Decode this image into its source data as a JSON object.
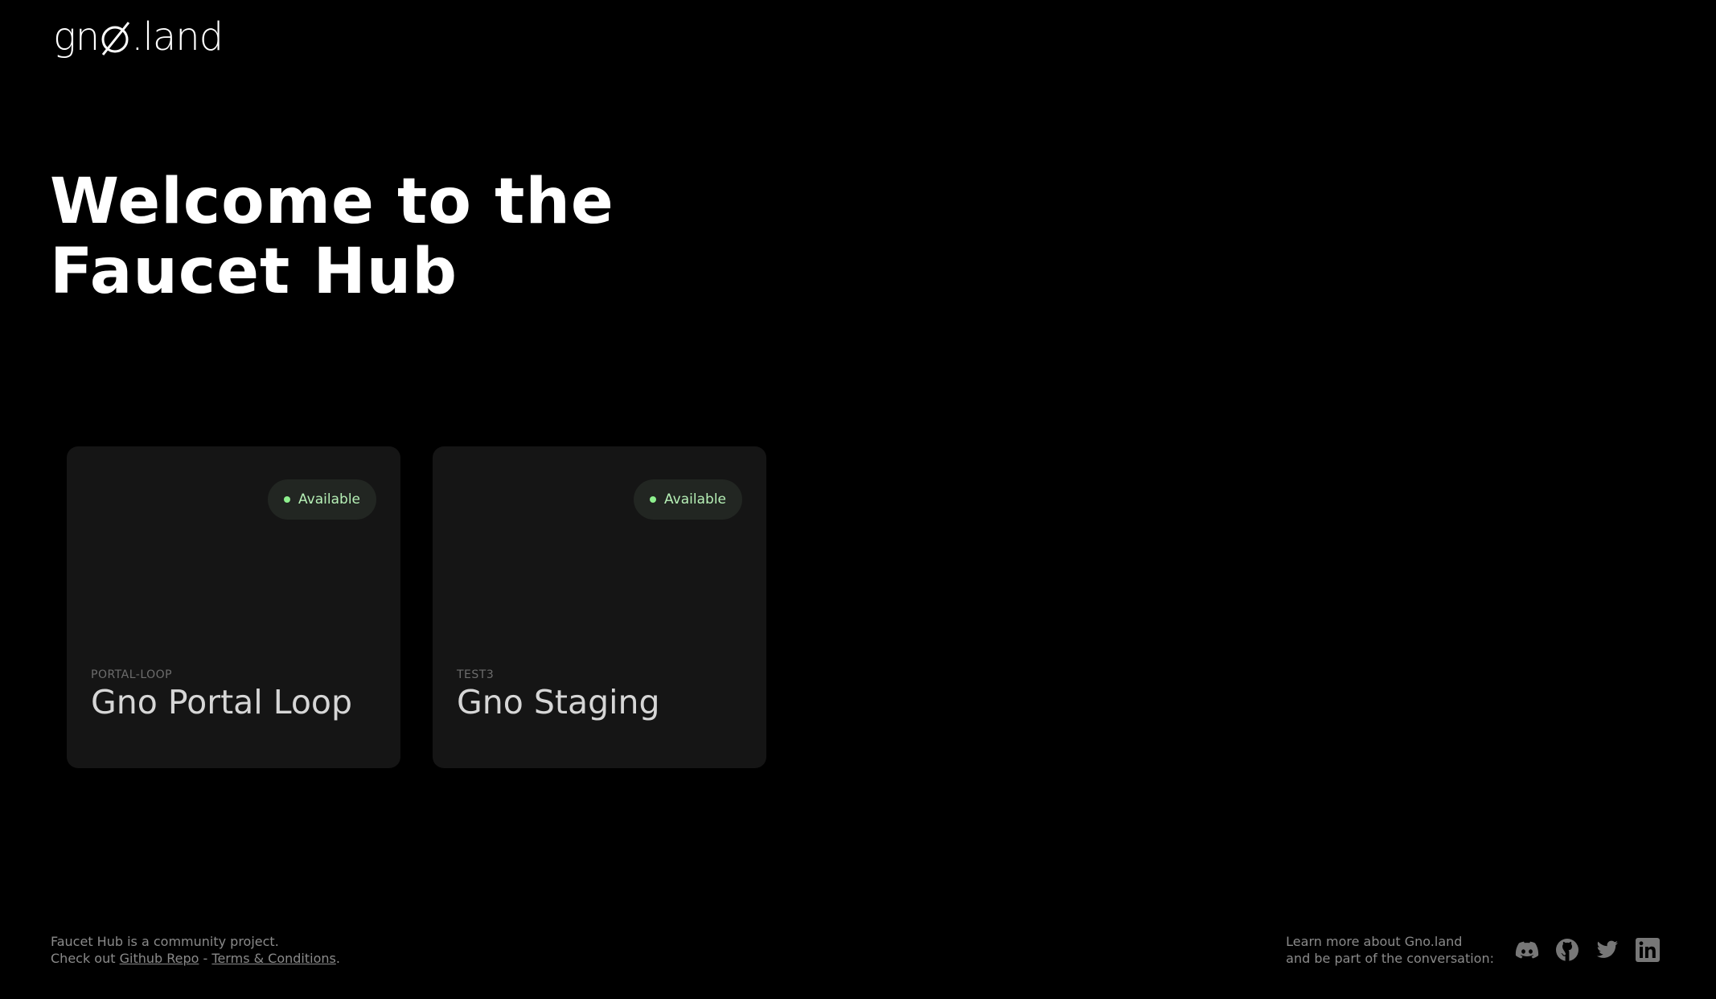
{
  "header": {
    "logo_left": "gn",
    "logo_right": ".land",
    "logo_icon": "slashed-o-icon"
  },
  "hero": {
    "line1": "Welcome to the",
    "line2": "Faucet Hub"
  },
  "faucets": [
    {
      "status": "Available",
      "slug": "PORTAL-LOOP",
      "name": "Gno Portal Loop"
    },
    {
      "status": "Available",
      "slug": "TEST3",
      "name": "Gno Staging"
    }
  ],
  "footer": {
    "left_line1": "Faucet Hub is a community project.",
    "left_line2_prefix": "Check out",
    "github_link": "Github Repo",
    "separator": "-",
    "terms_link": "Terms & Conditions",
    "end_period": ".",
    "learn_line1": "Learn more about Gno.land",
    "learn_line2": "and be part of the conversation:",
    "socials": [
      "discord-icon",
      "github-icon",
      "twitter-icon",
      "linkedin-icon"
    ]
  },
  "colors": {
    "background": "#000000",
    "card": "#151515",
    "badge_bg": "#222622",
    "badge_text": "#b6f0b6",
    "muted_text": "#8a8a8a"
  }
}
